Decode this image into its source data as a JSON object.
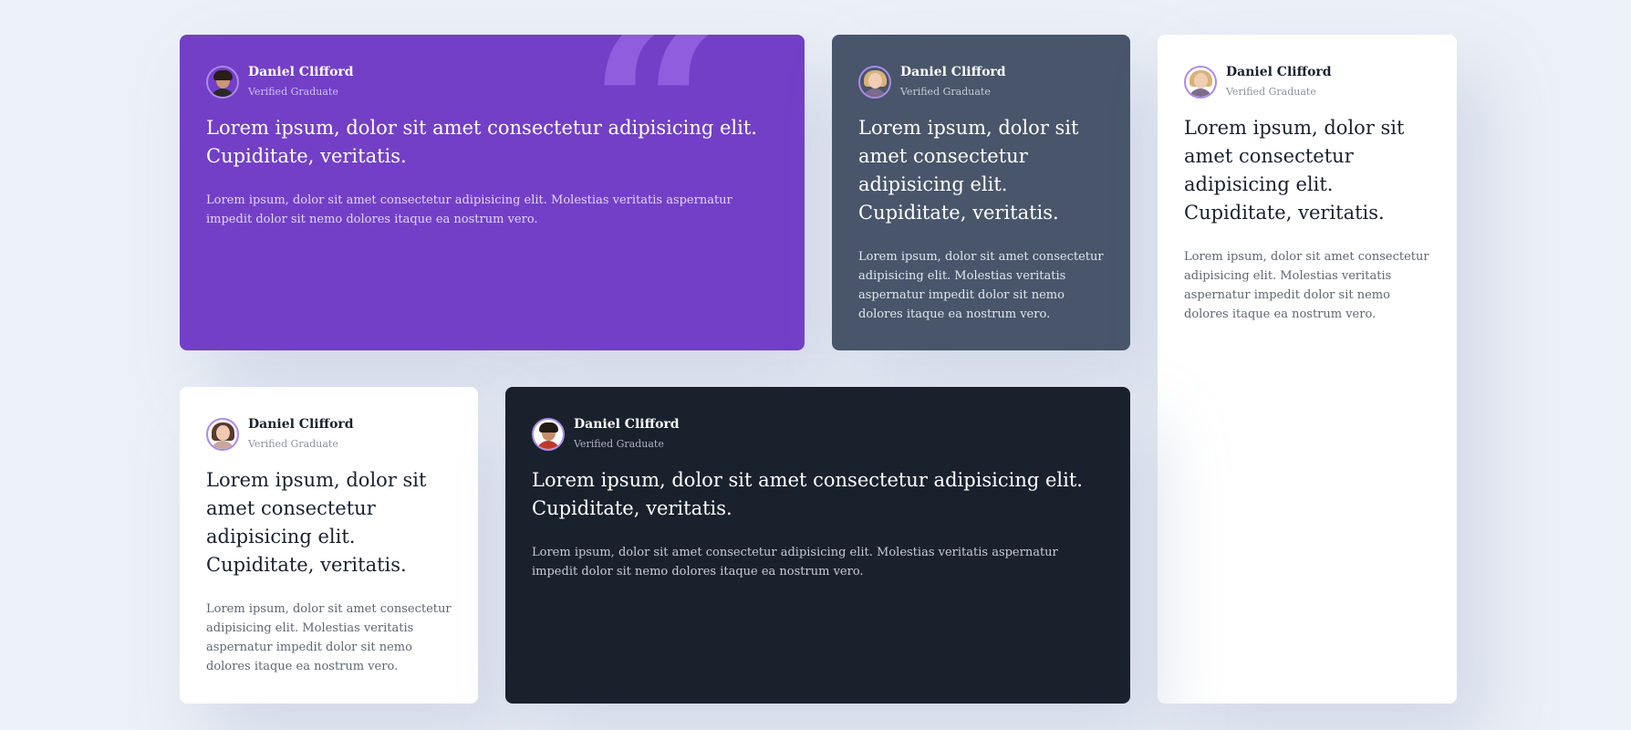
{
  "colors": {
    "page_background": "#ecf0f7",
    "purple": "#733fc6",
    "slate": "#48556a",
    "white": "#ffffff",
    "dark": "#19212d",
    "avatar_ring": "#a98bea"
  },
  "cards": [
    {
      "theme": "purple",
      "avatar_icon": "man-portrait-avatar",
      "name": "Daniel Clifford",
      "role": "Verified Graduate",
      "headline": "Lorem ipsum, dolor sit amet consectetur adipisicing elit. Cupiditate, veritatis.",
      "text": "Lorem ipsum, dolor sit amet consectetur adipisicing elit. Molestias veritatis aspernatur impedit dolor sit nemo dolores itaque ea nostrum vero."
    },
    {
      "theme": "slate",
      "avatar_icon": "woman-portrait-avatar",
      "name": "Daniel Clifford",
      "role": "Verified Graduate",
      "headline": "Lorem ipsum, dolor sit amet consectetur adipisicing elit. Cupiditate, veritatis.",
      "text": "Lorem ipsum, dolor sit amet consectetur adipisicing elit. Molestias veritatis aspernatur impedit dolor sit nemo dolores itaque ea nostrum vero."
    },
    {
      "theme": "white",
      "avatar_icon": "woman-portrait-avatar",
      "name": "Daniel Clifford",
      "role": "Verified Graduate",
      "headline": "Lorem ipsum, dolor sit amet consectetur adipisicing elit. Cupiditate, veritatis.",
      "text": "Lorem ipsum, dolor sit amet consectetur adipisicing elit. Molestias veritatis aspernatur impedit dolor sit nemo dolores itaque ea nostrum vero."
    },
    {
      "theme": "white",
      "avatar_icon": "woman-portrait-avatar",
      "name": "Daniel Clifford",
      "role": "Verified Graduate",
      "headline": "Lorem ipsum, dolor sit amet consectetur adipisicing elit. Cupiditate, veritatis.",
      "text": "Lorem ipsum, dolor sit amet consectetur adipisicing elit. Molestias veritatis aspernatur impedit dolor sit nemo dolores itaque ea nostrum vero."
    },
    {
      "theme": "dark",
      "avatar_icon": "man-portrait-avatar",
      "name": "Daniel Clifford",
      "role": "Verified Graduate",
      "headline": "Lorem ipsum, dolor sit amet consectetur adipisicing elit. Cupiditate, veritatis.",
      "text": "Lorem ipsum, dolor sit amet consectetur adipisicing elit. Molestias veritatis aspernatur impedit dolor sit nemo dolores itaque ea nostrum vero."
    }
  ],
  "decor": {
    "quote_icon": "quote-mark-icon",
    "quote_glyph": "“"
  }
}
